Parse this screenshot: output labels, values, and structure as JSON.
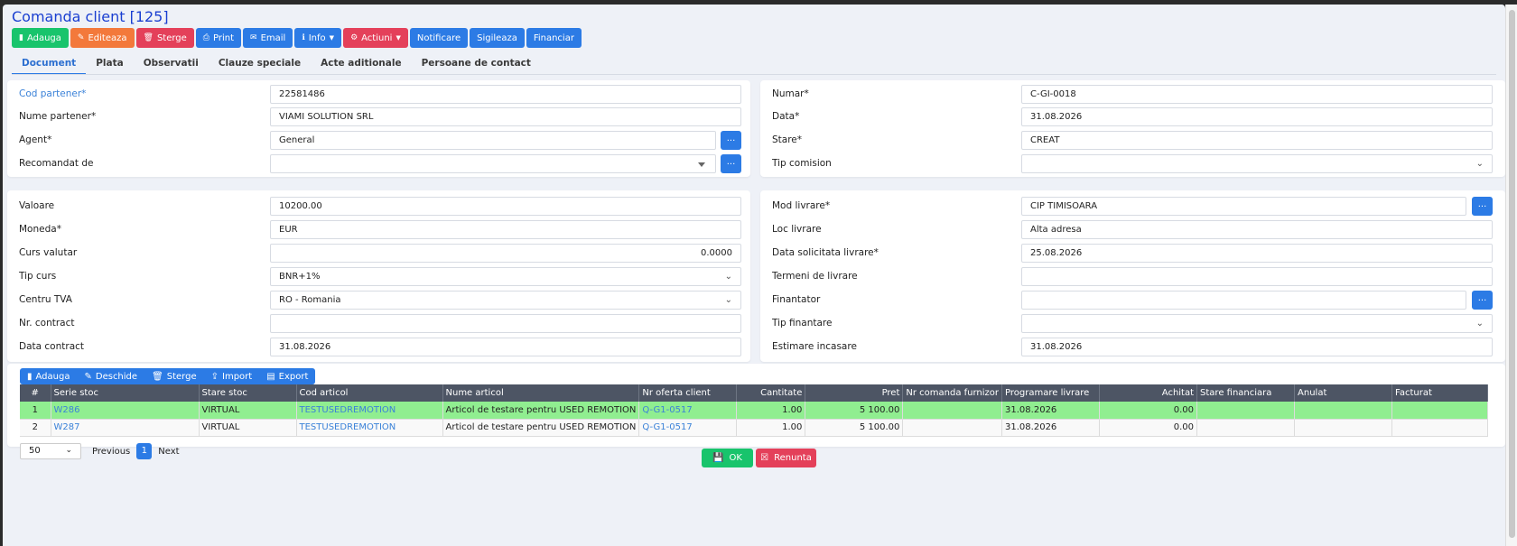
{
  "title": "Comanda client [125]",
  "toolbar": {
    "add": "Adauga",
    "edit": "Editeaza",
    "delete": "Sterge",
    "print": "Print",
    "email": "Email",
    "info": "Info",
    "actions": "Actiuni",
    "notify": "Notificare",
    "seal": "Sigileaza",
    "financial": "Financiar"
  },
  "tabs": [
    "Document",
    "Plata",
    "Observatii",
    "Clauze speciale",
    "Acte aditionale",
    "Persoane de contact"
  ],
  "partner": {
    "cod_label": "Cod partener*",
    "cod_value": "22581486",
    "nume_label": "Nume partener*",
    "nume_value": "VIAMI SOLUTION SRL",
    "agent_label": "Agent*",
    "agent_value": "General",
    "recomandat_label": "Recomandat de",
    "recomandat_value": ""
  },
  "doc": {
    "numar_label": "Numar*",
    "numar_value": "C-GI-0018",
    "data_label": "Data*",
    "data_value": "31.08.2026",
    "stare_label": "Stare*",
    "stare_value": "CREAT",
    "comision_label": "Tip comision",
    "comision_value": ""
  },
  "finance": {
    "valoare_label": "Valoare",
    "valoare_value": "10200.00",
    "moneda_label": "Moneda*",
    "moneda_value": "EUR",
    "curs_label": "Curs valutar",
    "curs_value": "0.0000",
    "tipcurs_label": "Tip curs",
    "tipcurs_value": "BNR+1%",
    "tva_label": "Centru TVA",
    "tva_value": "RO - Romania",
    "contract_label": "Nr. contract",
    "contract_value": "",
    "datacontract_label": "Data contract",
    "datacontract_value": "31.08.2026"
  },
  "delivery": {
    "mod_label": "Mod livrare*",
    "mod_value": "CIP TIMISOARA",
    "loc_label": "Loc livrare",
    "loc_value": "Alta adresa",
    "datasol_label": "Data solicitata livrare*",
    "datasol_value": "25.08.2026",
    "termeni_label": "Termeni de livrare",
    "termeni_value": "",
    "finantator_label": "Finantator",
    "finantator_value": "",
    "tipfin_label": "Tip finantare",
    "tipfin_value": "",
    "estimare_label": "Estimare incasare",
    "estimare_value": "31.08.2026"
  },
  "dots": "...",
  "grid": {
    "buttons": {
      "add": "Adauga",
      "open": "Deschide",
      "delete": "Sterge",
      "import": "Import",
      "export": "Export"
    },
    "columns": [
      "#",
      "Serie stoc",
      "Stare stoc",
      "Cod articol",
      "Nume articol",
      "Nr oferta client",
      "Cantitate",
      "Pret",
      "Nr comanda furnizor",
      "Programare livrare",
      "Achitat",
      "Stare financiara",
      "Anulat",
      "Facturat"
    ],
    "rows": [
      [
        "1",
        "W286",
        "VIRTUAL",
        "TESTUSEDREMOTION",
        "Articol de testare pentru USED REMOTION",
        "Q-G1-0517",
        "1.00",
        "5 100.00",
        "",
        "31.08.2026",
        "0.00",
        "",
        "",
        ""
      ],
      [
        "2",
        "W287",
        "VIRTUAL",
        "TESTUSEDREMOTION",
        "Articol de testare pentru USED REMOTION",
        "Q-G1-0517",
        "1.00",
        "5 100.00",
        "",
        "31.08.2026",
        "0.00",
        "",
        "",
        ""
      ]
    ]
  },
  "pager": {
    "size": "50",
    "prev": "Previous",
    "page": "1",
    "next": "Next"
  },
  "footer": {
    "ok": "OK",
    "cancel": "Renunta"
  },
  "colors": {
    "green": "#18c46c",
    "orange": "#f3793b",
    "red": "#e4405a",
    "blue": "#2c7be5",
    "row_highlight": "#90ee90",
    "header": "#4d5564",
    "title": "#1a3fd1"
  }
}
